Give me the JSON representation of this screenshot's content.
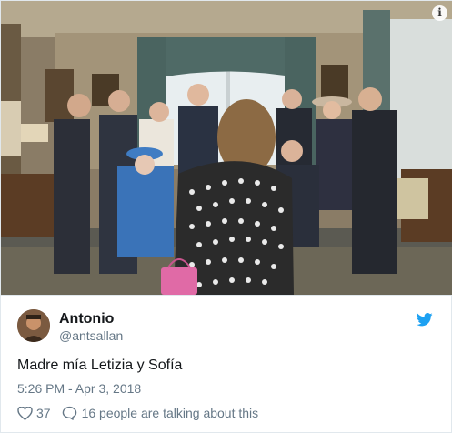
{
  "tweet": {
    "photo_alt_icon": "info-icon",
    "author": {
      "name": "Antonio",
      "handle": "@antsallan"
    },
    "text": "Madre mía Letizia y Sofía",
    "timestamp": "5:26 PM - Apr 3, 2018",
    "likes": "37",
    "talking": "16 people are talking about this",
    "icons": {
      "brand": "twitter-bird-icon",
      "like": "heart-icon",
      "reply": "speech-bubble-icon"
    }
  },
  "colors": {
    "twitter_blue": "#1da1f2",
    "secondary_text": "#657786",
    "primary_text": "#14171a"
  }
}
